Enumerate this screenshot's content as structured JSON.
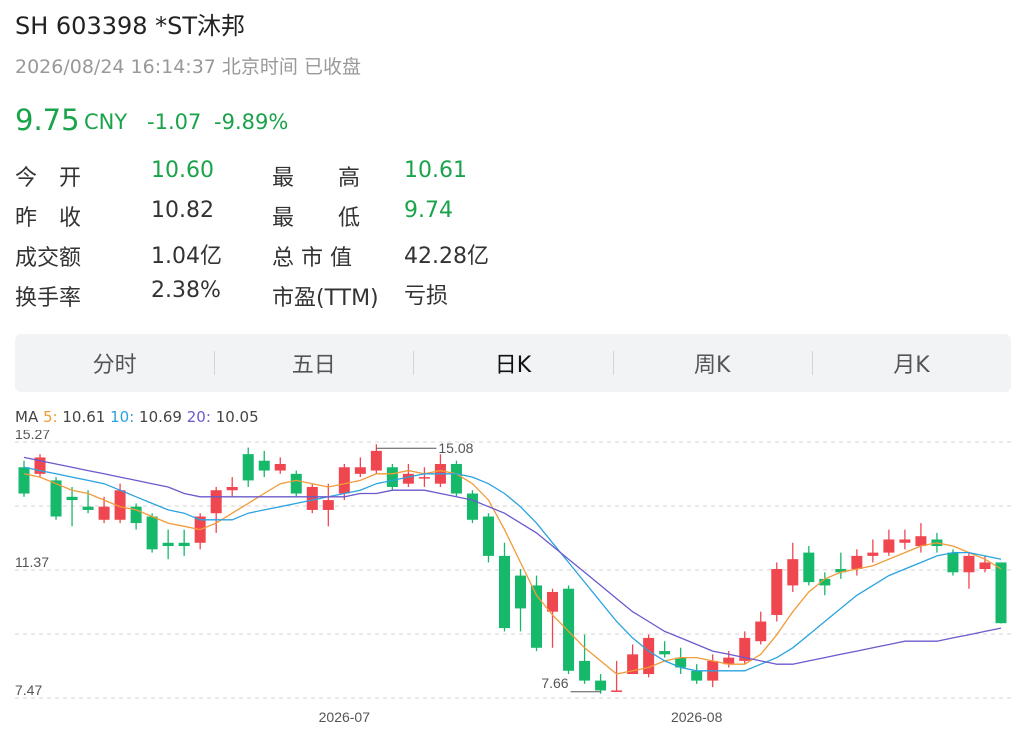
{
  "header": {
    "title": "SH 603398  *ST沐邦",
    "time": "2026/08/24 16:14:37 北京时间 已收盘",
    "price": "9.75",
    "currency": "CNY",
    "change": "-1.07",
    "change_pct": "-9.89%"
  },
  "stats": {
    "open_label": "今　开",
    "open_value": "10.60",
    "high_label": "最　　高",
    "high_value": "10.61",
    "prev_close_label": "昨　收",
    "prev_close_value": "10.82",
    "low_label": "最　　低",
    "low_value": "9.74",
    "volume_label": "成交额",
    "volume_value": "1.04亿",
    "mktcap_label": "总 市 值",
    "mktcap_value": "42.28亿",
    "turnover_label": "换手率",
    "turnover_value": "2.38%",
    "pe_label": "市盈(TTM)",
    "pe_value": "亏损"
  },
  "tabs": [
    {
      "label": "分时"
    },
    {
      "label": "五日"
    },
    {
      "label": "日K",
      "active": true
    },
    {
      "label": "周K"
    },
    {
      "label": "月K"
    }
  ],
  "ma_legend": {
    "ma": "MA",
    "ma5_label": "5:",
    "ma5_value": "10.61",
    "ma10_label": "10:",
    "ma10_value": "10.69",
    "ma20_label": "20:",
    "ma20_value": "10.05"
  },
  "colors": {
    "up": "#f0464f",
    "down": "#16b86a",
    "ma5": "#f29b38",
    "ma10": "#2aa3e0",
    "ma20": "#6a5acd"
  },
  "chart_data": {
    "type": "candlestick",
    "ylim": [
      7.47,
      15.27
    ],
    "y_ticks": [
      "15.27",
      "11.37",
      "7.47"
    ],
    "x_ticks": [
      "2026-07",
      "2026-08"
    ],
    "max_label": "15.08",
    "min_label": "7.66",
    "candles": [
      [
        14.5,
        13.7,
        14.7,
        13.6
      ],
      [
        14.3,
        14.8,
        14.9,
        14.2
      ],
      [
        14.1,
        13.0,
        14.2,
        12.9
      ],
      [
        13.6,
        13.5,
        13.9,
        12.7
      ],
      [
        13.3,
        13.2,
        13.8,
        13.1
      ],
      [
        12.9,
        13.3,
        13.6,
        12.8
      ],
      [
        12.9,
        13.8,
        14.0,
        12.8
      ],
      [
        13.3,
        12.8,
        13.4,
        12.6
      ],
      [
        13.0,
        12.0,
        13.1,
        11.9
      ],
      [
        12.2,
        12.1,
        12.6,
        11.7
      ],
      [
        12.2,
        12.1,
        12.6,
        11.8
      ],
      [
        12.2,
        13.0,
        13.1,
        12.0
      ],
      [
        13.1,
        13.8,
        13.9,
        12.5
      ],
      [
        13.8,
        13.9,
        14.2,
        13.6
      ],
      [
        14.9,
        14.1,
        15.1,
        13.9
      ],
      [
        14.7,
        14.4,
        15.0,
        14.2
      ],
      [
        14.4,
        14.6,
        14.8,
        14.3
      ],
      [
        14.3,
        13.7,
        14.4,
        13.6
      ],
      [
        13.2,
        13.9,
        14.0,
        13.1
      ],
      [
        13.2,
        13.5,
        14.0,
        12.7
      ],
      [
        13.7,
        14.5,
        14.6,
        13.5
      ],
      [
        14.3,
        14.5,
        14.8,
        14.2
      ],
      [
        14.4,
        15.0,
        15.2,
        14.3
      ],
      [
        14.5,
        13.9,
        14.6,
        13.8
      ],
      [
        14.0,
        14.3,
        14.6,
        13.9
      ],
      [
        14.2,
        14.2,
        14.5,
        13.9
      ],
      [
        14.0,
        14.6,
        14.9,
        13.9
      ],
      [
        14.6,
        13.7,
        14.7,
        13.6
      ],
      [
        13.7,
        12.9,
        13.8,
        12.8
      ],
      [
        13.0,
        11.8,
        13.1,
        11.6
      ],
      [
        11.8,
        9.6,
        12.2,
        9.5
      ],
      [
        11.2,
        10.2,
        11.4,
        9.5
      ],
      [
        10.9,
        9.0,
        11.2,
        8.9
      ],
      [
        10.1,
        10.7,
        10.8,
        9.0
      ],
      [
        10.8,
        8.3,
        10.9,
        8.2
      ],
      [
        8.6,
        8.0,
        9.4,
        7.9
      ],
      [
        8.0,
        7.7,
        8.2,
        7.6
      ],
      [
        7.7,
        7.7,
        8.6,
        7.66
      ],
      [
        8.2,
        8.8,
        9.1,
        8.2
      ],
      [
        8.2,
        9.3,
        9.4,
        8.1
      ],
      [
        8.9,
        8.8,
        9.2,
        8.7
      ],
      [
        8.7,
        8.4,
        9.0,
        8.2
      ],
      [
        8.3,
        8.0,
        8.5,
        7.9
      ],
      [
        8.0,
        8.6,
        8.8,
        7.8
      ],
      [
        8.5,
        8.7,
        8.9,
        8.4
      ],
      [
        8.6,
        9.3,
        9.5,
        8.5
      ],
      [
        9.2,
        9.8,
        10.1,
        9.1
      ],
      [
        10.0,
        11.4,
        11.6,
        9.8
      ],
      [
        10.9,
        11.7,
        12.2,
        10.7
      ],
      [
        11.9,
        11.0,
        12.1,
        10.9
      ],
      [
        11.1,
        10.9,
        11.3,
        10.6
      ],
      [
        11.4,
        11.3,
        11.9,
        11.1
      ],
      [
        11.4,
        11.8,
        12.0,
        11.2
      ],
      [
        11.8,
        11.9,
        12.3,
        11.6
      ],
      [
        11.9,
        12.3,
        12.6,
        11.8
      ],
      [
        12.2,
        12.3,
        12.6,
        12.0
      ],
      [
        12.1,
        12.4,
        12.8,
        11.9
      ],
      [
        12.3,
        12.1,
        12.5,
        11.9
      ],
      [
        11.9,
        11.3,
        12.0,
        11.2
      ],
      [
        11.3,
        11.8,
        11.9,
        10.8
      ],
      [
        11.4,
        11.6,
        11.8,
        11.3
      ],
      [
        11.6,
        9.75,
        11.6,
        9.74
      ]
    ],
    "ma5": [
      14.3,
      14.2,
      14.0,
      13.8,
      13.7,
      13.5,
      13.3,
      13.2,
      13.0,
      12.8,
      12.7,
      12.6,
      12.8,
      13.1,
      13.4,
      13.7,
      14.0,
      14.1,
      14.0,
      13.9,
      14.0,
      14.1,
      14.3,
      14.3,
      14.4,
      14.3,
      14.4,
      14.3,
      14.0,
      13.5,
      12.6,
      11.6,
      10.6,
      10.0,
      9.5,
      9.0,
      8.6,
      8.2,
      8.3,
      8.4,
      8.6,
      8.7,
      8.7,
      8.6,
      8.5,
      8.5,
      8.8,
      9.4,
      10.1,
      10.7,
      11.1,
      11.3,
      11.4,
      11.5,
      11.7,
      11.9,
      12.1,
      12.2,
      12.1,
      11.9,
      11.7,
      11.4
    ],
    "ma10": [
      14.5,
      14.4,
      14.3,
      14.2,
      14.1,
      14.0,
      13.8,
      13.6,
      13.4,
      13.2,
      13.1,
      12.9,
      12.9,
      12.9,
      13.1,
      13.2,
      13.3,
      13.4,
      13.5,
      13.6,
      13.7,
      13.8,
      14.0,
      14.1,
      14.2,
      14.3,
      14.3,
      14.3,
      14.2,
      14.0,
      13.7,
      13.3,
      12.8,
      12.2,
      11.6,
      11.0,
      10.4,
      9.8,
      9.3,
      8.9,
      8.6,
      8.4,
      8.3,
      8.3,
      8.3,
      8.3,
      8.5,
      8.7,
      9.0,
      9.4,
      9.8,
      10.2,
      10.6,
      10.9,
      11.2,
      11.4,
      11.6,
      11.8,
      11.9,
      11.9,
      11.8,
      11.7
    ],
    "ma20": [
      14.8,
      14.7,
      14.6,
      14.5,
      14.4,
      14.3,
      14.2,
      14.1,
      14.0,
      13.9,
      13.7,
      13.6,
      13.6,
      13.6,
      13.6,
      13.6,
      13.6,
      13.6,
      13.6,
      13.6,
      13.6,
      13.7,
      13.7,
      13.8,
      13.8,
      13.8,
      13.7,
      13.6,
      13.5,
      13.3,
      13.1,
      12.8,
      12.5,
      12.1,
      11.7,
      11.3,
      10.9,
      10.5,
      10.1,
      9.8,
      9.5,
      9.3,
      9.1,
      8.9,
      8.8,
      8.7,
      8.6,
      8.5,
      8.5,
      8.6,
      8.7,
      8.8,
      8.9,
      9.0,
      9.1,
      9.2,
      9.2,
      9.2,
      9.3,
      9.4,
      9.5,
      9.6
    ]
  }
}
